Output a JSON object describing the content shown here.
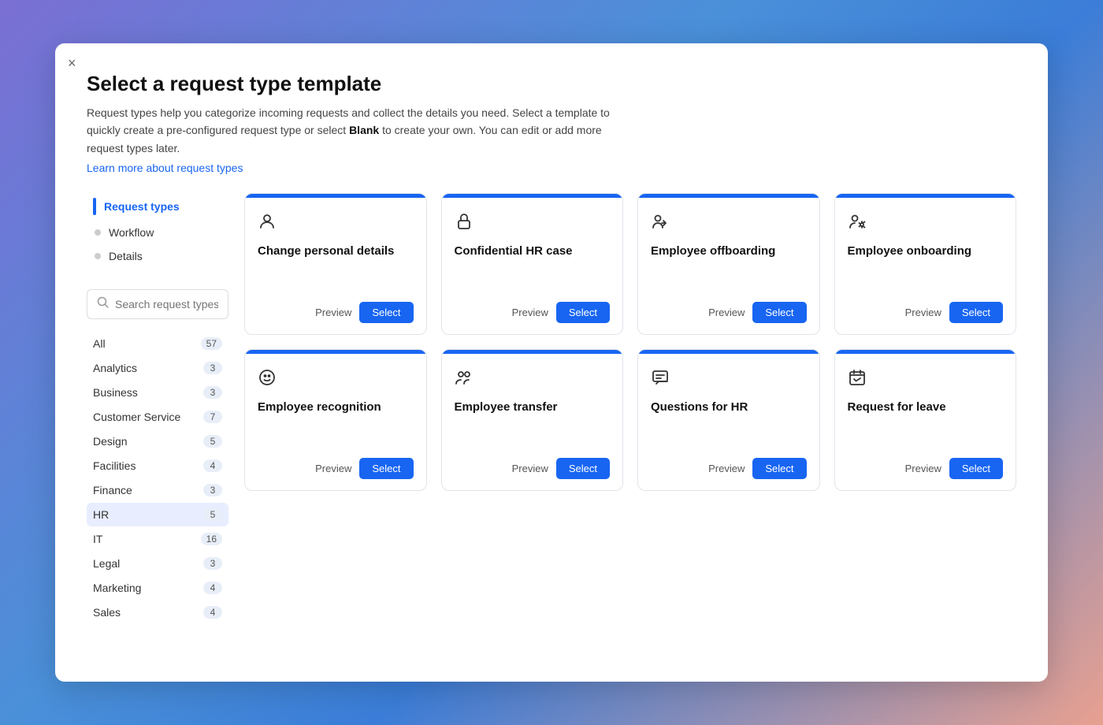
{
  "modal": {
    "close_label": "×",
    "title": "Select a request type template",
    "description_part1": "Request types help you categorize incoming requests and collect the details you need. Select a template to quickly create a pre-configured request type or select ",
    "description_bold": "Blank",
    "description_part2": " to create your own. You can edit or add more request types later.",
    "learn_more_link": "Learn more about request types"
  },
  "sidebar": {
    "nav_items": [
      {
        "id": "request-types",
        "label": "Request types",
        "active": true
      },
      {
        "id": "workflow",
        "label": "Workflow",
        "active": false
      },
      {
        "id": "details",
        "label": "Details",
        "active": false
      }
    ],
    "search_placeholder": "Search request types",
    "categories": [
      {
        "id": "all",
        "label": "All",
        "count": 57
      },
      {
        "id": "analytics",
        "label": "Analytics",
        "count": 3
      },
      {
        "id": "business",
        "label": "Business",
        "count": 3
      },
      {
        "id": "customer-service",
        "label": "Customer Service",
        "count": 7
      },
      {
        "id": "design",
        "label": "Design",
        "count": 5
      },
      {
        "id": "facilities",
        "label": "Facilities",
        "count": 4
      },
      {
        "id": "finance",
        "label": "Finance",
        "count": 3
      },
      {
        "id": "hr",
        "label": "HR",
        "count": 5,
        "selected": true
      },
      {
        "id": "it",
        "label": "IT",
        "count": 16
      },
      {
        "id": "legal",
        "label": "Legal",
        "count": 3
      },
      {
        "id": "marketing",
        "label": "Marketing",
        "count": 4
      },
      {
        "id": "sales",
        "label": "Sales",
        "count": 4
      }
    ]
  },
  "cards": [
    {
      "id": "change-personal-details",
      "icon": "👤",
      "icon_type": "person",
      "title": "Change personal details",
      "preview_label": "Preview",
      "select_label": "Select"
    },
    {
      "id": "confidential-hr-case",
      "icon": "🔒",
      "icon_type": "lock",
      "title": "Confidential HR case",
      "preview_label": "Preview",
      "select_label": "Select"
    },
    {
      "id": "employee-offboarding",
      "icon": "👤➡",
      "icon_type": "person-arrow-out",
      "title": "Employee offboarding",
      "preview_label": "Preview",
      "select_label": "Select"
    },
    {
      "id": "employee-onboarding",
      "icon": "👤⚙",
      "icon_type": "person-gear",
      "title": "Employee onboarding",
      "preview_label": "Preview",
      "select_label": "Select"
    },
    {
      "id": "employee-recognition",
      "icon": "😊",
      "icon_type": "smiley",
      "title": "Employee recognition",
      "preview_label": "Preview",
      "select_label": "Select"
    },
    {
      "id": "employee-transfer",
      "icon": "👥",
      "icon_type": "people-transfer",
      "title": "Employee transfer",
      "preview_label": "Preview",
      "select_label": "Select"
    },
    {
      "id": "questions-for-hr",
      "icon": "💬",
      "icon_type": "chat",
      "title": "Questions for HR",
      "preview_label": "Preview",
      "select_label": "Select"
    },
    {
      "id": "request-for-leave",
      "icon": "📅",
      "icon_type": "calendar-check",
      "title": "Request for leave",
      "preview_label": "Preview",
      "select_label": "Select"
    }
  ],
  "colors": {
    "accent": "#1865f2",
    "selected_bg": "#e8eeff"
  }
}
